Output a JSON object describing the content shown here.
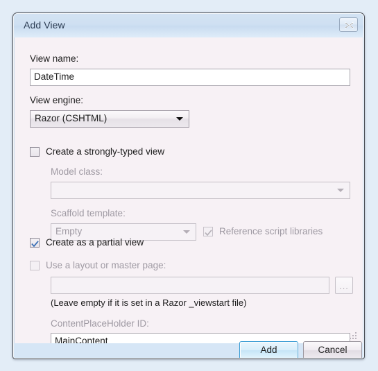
{
  "window": {
    "title": "Add View",
    "close_icon": "close-x-icon"
  },
  "form": {
    "view_name_label": "View name:",
    "view_name_value": "DateTime",
    "view_engine_label": "View engine:",
    "view_engine_value": "Razor (CSHTML)",
    "strongly_typed_label": "Create a strongly-typed view",
    "model_class_label": "Model class:",
    "model_class_value": "",
    "scaffold_template_label": "Scaffold template:",
    "scaffold_template_value": "Empty",
    "reference_script_label": "Reference script libraries",
    "partial_view_label": "Create as a partial view",
    "layout_master_label": "Use a layout or master page:",
    "layout_path_value": "",
    "browse_button_label": "...",
    "layout_hint": "(Leave empty if it is set in a Razor _viewstart file)",
    "content_placeholder_label": "ContentPlaceHolder ID:",
    "content_placeholder_value": "MainContent"
  },
  "footer": {
    "add_label": "Add",
    "cancel_label": "Cancel"
  }
}
